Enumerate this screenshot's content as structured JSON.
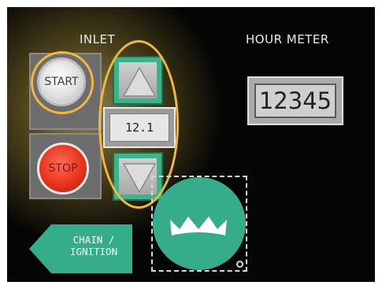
{
  "labels": {
    "inlet": "INLET",
    "hour_meter": "HOUR METER"
  },
  "buttons": {
    "start": "START",
    "stop": "STOP",
    "chain_ignition": "CHAIN /\nIGNITION"
  },
  "inlet": {
    "value": "12.1"
  },
  "hour_meter": {
    "value": "12345"
  },
  "colors": {
    "accent_green": "#36ad8a",
    "highlight": "#f4b73a",
    "stop_red": "#e8341d",
    "background": "#050505"
  },
  "icons": {
    "increase": "up-arrow-icon",
    "decrease": "down-arrow-icon",
    "logo": "crown-icon"
  }
}
